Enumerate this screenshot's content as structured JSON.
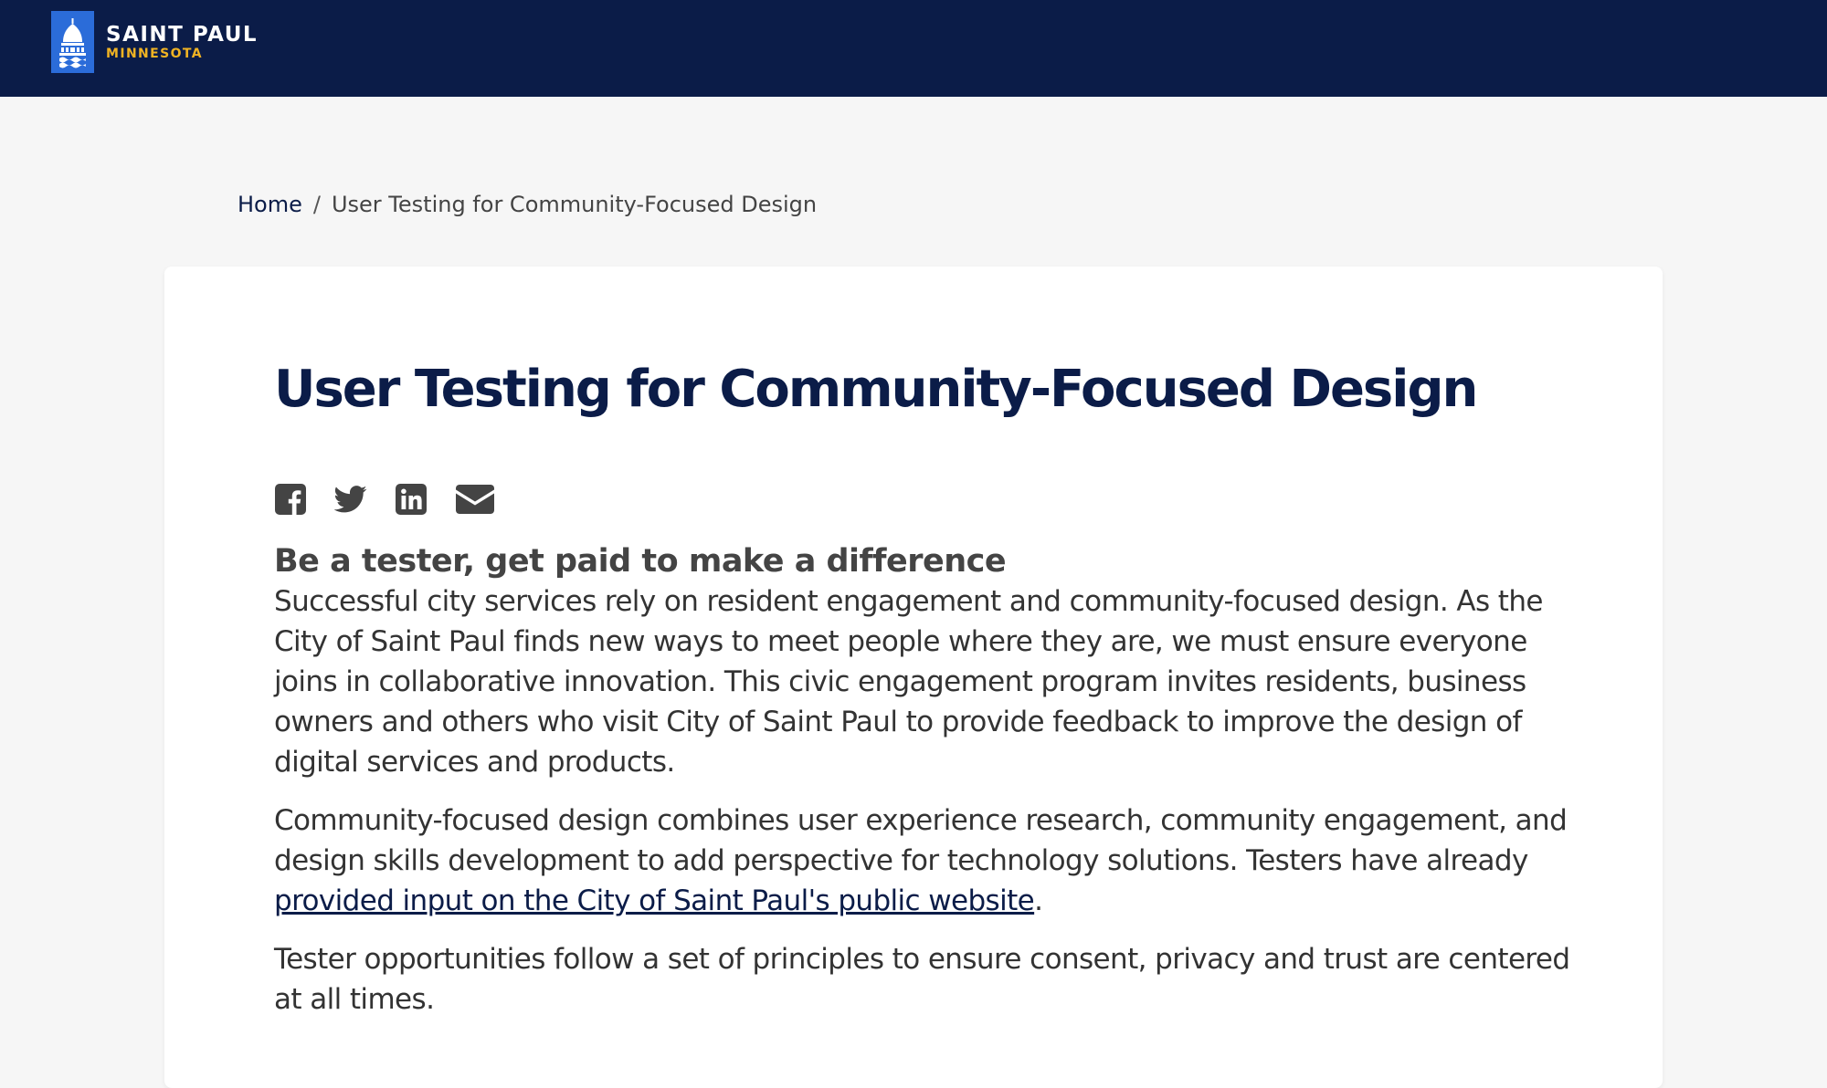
{
  "header": {
    "logo_title": "SAINT PAUL",
    "logo_subtitle": "MINNESOTA",
    "logo_icon": "capitol-dome-icon",
    "background_color": "#0b1c48",
    "logo_box_color": "#2b6cd9",
    "subtitle_color": "#f0b323"
  },
  "breadcrumb": {
    "home_label": "Home",
    "separator": "/",
    "current_label": "User Testing for Community-Focused Design"
  },
  "page": {
    "title": "User Testing for Community-Focused Design",
    "share_icons": [
      "facebook-icon",
      "twitter-icon",
      "linkedin-icon",
      "email-icon"
    ],
    "subheading": "Be a tester, get paid to make a difference",
    "paragraph1": "Successful city services rely on resident engagement and community-focused design. As the City of Saint Paul finds new ways to meet people where they are, we must ensure everyone joins in collaborative innovation. This civic engagement program invites residents, business owners and others who visit City of Saint Paul to provide feedback to improve the design of digital services and products.",
    "paragraph2_text": "Community-focused design combines user experience research, community engagement, and design skills development to add perspective for technology solutions. Testers have already",
    "paragraph2_link": "provided input on the City of Saint Paul's public website",
    "paragraph2_end": ".",
    "paragraph3": "Tester opportunities follow a set of principles to ensure consent, privacy and trust are centered at all times."
  }
}
